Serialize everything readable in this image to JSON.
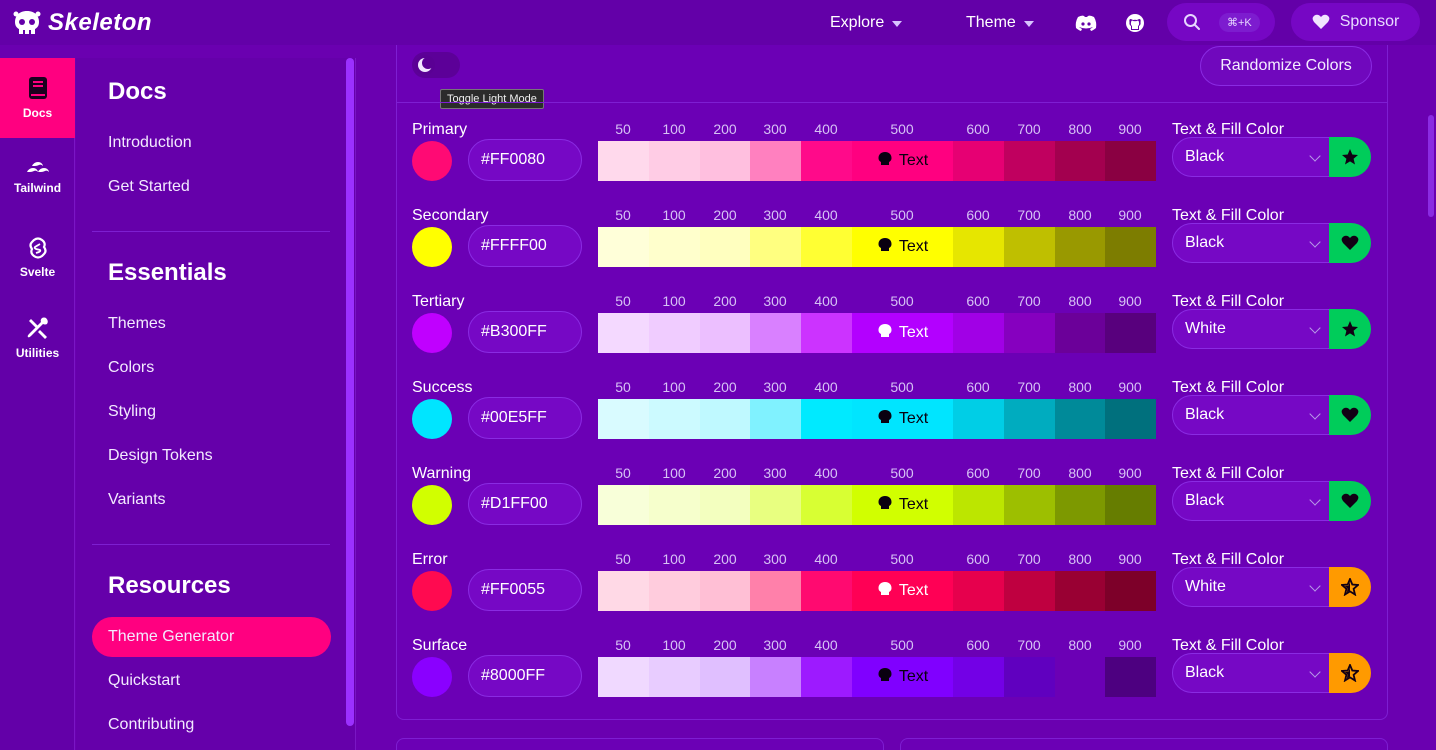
{
  "app": {
    "name": "Skeleton"
  },
  "topbar": {
    "explore_label": "Explore",
    "theme_label": "Theme",
    "search_shortcut": "⌘+K",
    "sponsor_label": "Sponsor",
    "icons": [
      "discord-icon",
      "github-icon",
      "search-icon",
      "heart-icon"
    ]
  },
  "rail": {
    "items": [
      {
        "label": "Docs",
        "icon": "book-icon",
        "active": true
      },
      {
        "label": "Tailwind",
        "icon": "tailwind-icon"
      },
      {
        "label": "Svelte",
        "icon": "svelte-icon"
      },
      {
        "label": "Utilities",
        "icon": "tools-icon"
      }
    ]
  },
  "sidebar": {
    "sections": [
      {
        "title": "Docs",
        "links": [
          "Introduction",
          "Get Started"
        ]
      },
      {
        "title": "Essentials",
        "links": [
          "Themes",
          "Colors",
          "Styling",
          "Design Tokens",
          "Variants"
        ]
      },
      {
        "title": "Resources",
        "links": [
          "Theme Generator",
          "Quickstart",
          "Contributing"
        ]
      }
    ],
    "active_link": "Theme Generator"
  },
  "generator": {
    "toggle_tooltip": "Toggle Light Mode",
    "randomize_label": "Randomize Colors",
    "shade_labels": [
      "50",
      "100",
      "200",
      "300",
      "400",
      "500",
      "600",
      "700",
      "800",
      "900"
    ],
    "sample_text": "Text",
    "text_fill_label": "Text & Fill Color",
    "rows": [
      {
        "name": "Primary",
        "hex": "#FF0080",
        "swatch": "#ff0a74",
        "text_color": "Black",
        "fill_icon": "star-icon",
        "fill_bg": "#00cc5a",
        "shades": [
          "#ffd9ec",
          "#ffcce5",
          "#ffbfdf",
          "#ff80bf",
          "#ff0a8a",
          "#ff0080",
          "#e60073",
          "#c0005f",
          "#a3004f",
          "#8a0042"
        ]
      },
      {
        "name": "Secondary",
        "hex": "#FFFF00",
        "swatch": "#ffff00",
        "text_color": "Black",
        "fill_icon": "heart-icon",
        "fill_bg": "#00cc5a",
        "shades": [
          "#ffffd9",
          "#ffffcc",
          "#ffffbf",
          "#ffff80",
          "#ffff33",
          "#ffff00",
          "#e6e600",
          "#bfbf00",
          "#999900",
          "#7d7d00"
        ]
      },
      {
        "name": "Tertiary",
        "hex": "#B300FF",
        "swatch": "#c000ff",
        "text_color": "White",
        "fill_icon": "star-icon",
        "fill_bg": "#00cc5a",
        "shades": [
          "#f4d9ff",
          "#f0ccff",
          "#ecbfff",
          "#d980ff",
          "#cc33ff",
          "#b300ff",
          "#a100e6",
          "#8600bf",
          "#6b0099",
          "#58007d"
        ]
      },
      {
        "name": "Success",
        "hex": "#00E5FF",
        "swatch": "#00e5ff",
        "text_color": "Black",
        "fill_icon": "heart-icon",
        "fill_bg": "#00cc5a",
        "shades": [
          "#d9fbff",
          "#ccfaff",
          "#bff9ff",
          "#80f2ff",
          "#00eaff",
          "#00e5ff",
          "#00cee6",
          "#00acbf",
          "#008a99",
          "#00707d"
        ]
      },
      {
        "name": "Warning",
        "hex": "#D1FF00",
        "swatch": "#d1ff00",
        "text_color": "Black",
        "fill_icon": "heart-icon",
        "fill_bg": "#00cc5a",
        "shades": [
          "#f8ffd9",
          "#f6ffcc",
          "#f3ffbf",
          "#e8ff80",
          "#d8ff33",
          "#d1ff00",
          "#bce600",
          "#9dbf00",
          "#7d9900",
          "#667d00"
        ]
      },
      {
        "name": "Error",
        "hex": "#FF0055",
        "swatch": "#ff0a50",
        "text_color": "White",
        "fill_icon": "star-outline-icon",
        "fill_bg": "#ff9a00",
        "shades": [
          "#ffd9e6",
          "#ffccdd",
          "#ffbfd5",
          "#ff80aa",
          "#ff0a70",
          "#ff0055",
          "#e6004d",
          "#bf0040",
          "#990033",
          "#7d0029"
        ]
      },
      {
        "name": "Surface",
        "hex": "#8000FF",
        "swatch": "#8a00ff",
        "text_color": "Black",
        "fill_icon": "star-outline-icon",
        "fill_bg": "#ff9a00",
        "shades": [
          "#f0d9ff",
          "#e8ccff",
          "#e0bfff",
          "#c880ff",
          "#9d1aff",
          "#8000ff",
          "#7300e6",
          "#6000bf",
          "#6b00b5",
          "#4d0080"
        ]
      }
    ]
  }
}
